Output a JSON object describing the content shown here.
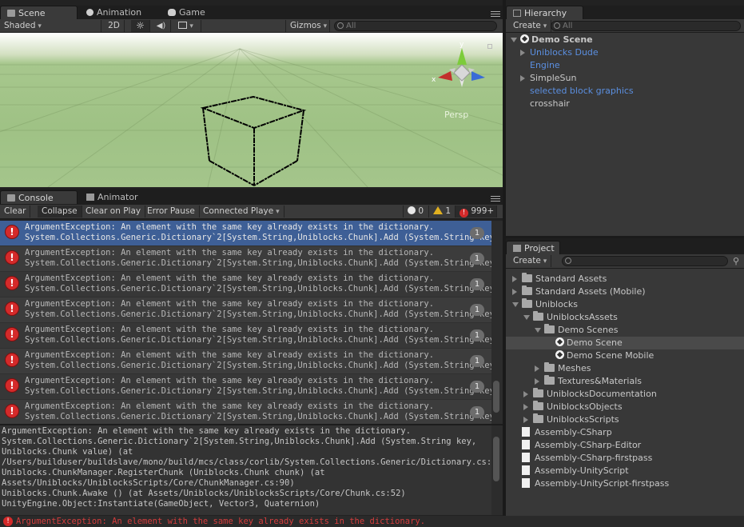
{
  "scene_panel": {
    "tabs": [
      {
        "label": "Scene",
        "icon": "scene-icon"
      },
      {
        "label": "Animation",
        "icon": "animation-icon"
      },
      {
        "label": "Game",
        "icon": "game-icon"
      }
    ],
    "toolbar": {
      "shading_mode": "Shaded",
      "mode_2d": "2D",
      "gizmos_label": "Gizmos",
      "search_placeholder": "All"
    },
    "gizmo": {
      "axis_x": "x",
      "axis_y": "y",
      "view_label": "Persp"
    }
  },
  "console_panel": {
    "tabs": [
      {
        "label": "Console",
        "icon": "console-icon"
      },
      {
        "label": "Animator",
        "icon": "animator-icon"
      }
    ],
    "toolbar": {
      "clear": "Clear",
      "collapse": "Collapse",
      "clear_on_play": "Clear on Play",
      "error_pause": "Error Pause",
      "connected_player": "Connected Playe",
      "log_count": "0",
      "warning_count": "1",
      "error_count": "999+"
    },
    "entries": [
      {
        "line1": "ArgumentException: An element with the same key already exists in the dictionary.",
        "line2": "System.Collections.Generic.Dictionary`2[System.String,Uniblocks.Chunk].Add (System.String key, Un",
        "count": "1"
      },
      {
        "line1": "ArgumentException: An element with the same key already exists in the dictionary.",
        "line2": "System.Collections.Generic.Dictionary`2[System.String,Uniblocks.Chunk].Add (System.String key, Un",
        "count": "1"
      },
      {
        "line1": "ArgumentException: An element with the same key already exists in the dictionary.",
        "line2": "System.Collections.Generic.Dictionary`2[System.String,Uniblocks.Chunk].Add (System.String key, Un",
        "count": "1"
      },
      {
        "line1": "ArgumentException: An element with the same key already exists in the dictionary.",
        "line2": "System.Collections.Generic.Dictionary`2[System.String,Uniblocks.Chunk].Add (System.String key, Un",
        "count": "1"
      },
      {
        "line1": "ArgumentException: An element with the same key already exists in the dictionary.",
        "line2": "System.Collections.Generic.Dictionary`2[System.String,Uniblocks.Chunk].Add (System.String key, Un",
        "count": "1"
      },
      {
        "line1": "ArgumentException: An element with the same key already exists in the dictionary.",
        "line2": "System.Collections.Generic.Dictionary`2[System.String,Uniblocks.Chunk].Add (System.String key, Un",
        "count": "1"
      },
      {
        "line1": "ArgumentException: An element with the same key already exists in the dictionary.",
        "line2": "System.Collections.Generic.Dictionary`2[System.String,Uniblocks.Chunk].Add (System.String key, Un",
        "count": "1"
      },
      {
        "line1": "ArgumentException: An element with the same key already exists in the dictionary.",
        "line2": "System.Collections.Generic.Dictionary`2[System.String,Uniblocks.Chunk].Add (System.String key, Un",
        "count": "1"
      }
    ],
    "detail_lines": [
      "ArgumentException: An element with the same key already exists in the dictionary.",
      "System.Collections.Generic.Dictionary`2[System.String,Uniblocks.Chunk].Add (System.String key,",
      "Uniblocks.Chunk value) (at",
      "/Users/builduser/buildslave/mono/build/mcs/class/corlib/System.Collections.Generic/Dictionary.cs:404)",
      "Uniblocks.ChunkManager.RegisterChunk (Uniblocks.Chunk chunk) (at",
      "Assets/Uniblocks/UniblocksScripts/Core/ChunkManager.cs:90)",
      "Uniblocks.Chunk.Awake () (at Assets/Uniblocks/UniblocksScripts/Core/Chunk.cs:52)",
      "UnityEngine.Object:Instantiate(GameObject, Vector3, Quaternion)"
    ]
  },
  "status_bar": {
    "message": "ArgumentException: An element with the same key already exists in the dictionary."
  },
  "hierarchy_panel": {
    "tab": "Hierarchy",
    "create_label": "Create",
    "search_placeholder": "All",
    "scene_name": "Demo Scene",
    "items": [
      {
        "label": "Uniblocks Dude",
        "expandable": true,
        "prefab": true
      },
      {
        "label": "Engine",
        "expandable": false,
        "prefab": true
      },
      {
        "label": "SimpleSun",
        "expandable": true,
        "prefab": false
      },
      {
        "label": "selected block graphics",
        "expandable": false,
        "prefab": true
      },
      {
        "label": "crosshair",
        "expandable": false,
        "prefab": false
      }
    ]
  },
  "project_panel": {
    "tab": "Project",
    "create_label": "Create",
    "items": [
      {
        "label": "Standard Assets",
        "type": "folder",
        "depth": 0,
        "expander": "right"
      },
      {
        "label": "Standard Assets (Mobile)",
        "type": "folder",
        "depth": 0,
        "expander": "right"
      },
      {
        "label": "Uniblocks",
        "type": "folder",
        "depth": 0,
        "expander": "down"
      },
      {
        "label": "UniblocksAssets",
        "type": "folder",
        "depth": 1,
        "expander": "down"
      },
      {
        "label": "Demo Scenes",
        "type": "folder",
        "depth": 2,
        "expander": "down"
      },
      {
        "label": "Demo Scene",
        "type": "scene",
        "depth": 3,
        "expander": "none",
        "selected": true
      },
      {
        "label": "Demo Scene Mobile",
        "type": "scene",
        "depth": 3,
        "expander": "none"
      },
      {
        "label": "Meshes",
        "type": "folder",
        "depth": 2,
        "expander": "right"
      },
      {
        "label": "Textures&Materials",
        "type": "folder",
        "depth": 2,
        "expander": "right"
      },
      {
        "label": "UniblocksDocumentation",
        "type": "folder",
        "depth": 1,
        "expander": "right"
      },
      {
        "label": "UniblocksObjects",
        "type": "folder",
        "depth": 1,
        "expander": "right"
      },
      {
        "label": "UniblocksScripts",
        "type": "folder",
        "depth": 1,
        "expander": "right"
      },
      {
        "label": "Assembly-CSharp",
        "type": "file",
        "depth": 0,
        "expander": "none"
      },
      {
        "label": "Assembly-CSharp-Editor",
        "type": "file",
        "depth": 0,
        "expander": "none"
      },
      {
        "label": "Assembly-CSharp-firstpass",
        "type": "file",
        "depth": 0,
        "expander": "none"
      },
      {
        "label": "Assembly-UnityScript",
        "type": "file",
        "depth": 0,
        "expander": "none"
      },
      {
        "label": "Assembly-UnityScript-firstpass",
        "type": "file",
        "depth": 0,
        "expander": "none"
      }
    ]
  },
  "colors": {
    "selection": "#3e5f96",
    "prefab_blue": "#5b8fe0",
    "error_red": "#d42a2a",
    "warning_yellow": "#e0b020"
  }
}
